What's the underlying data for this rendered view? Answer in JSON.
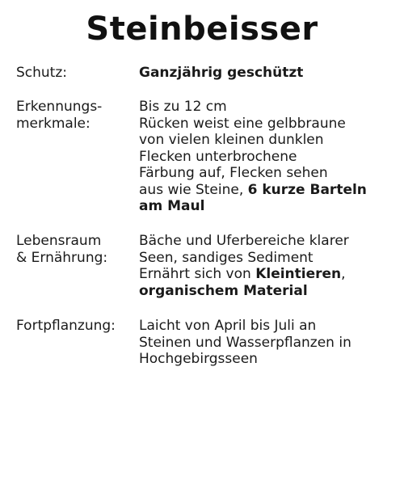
{
  "title": "Steinbeisser",
  "rows": [
    {
      "label_lines": [
        "Schutz:"
      ],
      "value_bold": "Ganzjährig geschützt"
    },
    {
      "label_lines": [
        "Erkennungs-",
        "merkmale:"
      ],
      "value_lines": [
        "Bis zu 12 cm",
        "Rücken weist eine gelbbraune",
        "von vielen kleinen dunklen",
        "Flecken unterbrochene",
        "Färbung auf, Flecken sehen"
      ],
      "value_mixed_prefix": "aus wie Steine, ",
      "value_mixed_bold": "6 kurze Barteln",
      "value_last_bold": "am Maul"
    },
    {
      "label_lines": [
        "Lebensraum",
        "& Ernährung:"
      ],
      "value_lines": [
        "Bäche und Uferbereiche klarer",
        "Seen, sandiges Sediment"
      ],
      "value_mixed_prefix": "Ernährt sich von ",
      "value_mixed_bold": "Kleintieren",
      "value_mixed_suffix": ",",
      "value_last_bold": "organischem Material"
    },
    {
      "label_lines": [
        "Fortpflanzung:"
      ],
      "value_lines": [
        "Laicht von April bis Juli an",
        "Steinen und Wasserpflanzen in",
        "Hochgebirgsseen"
      ]
    }
  ]
}
